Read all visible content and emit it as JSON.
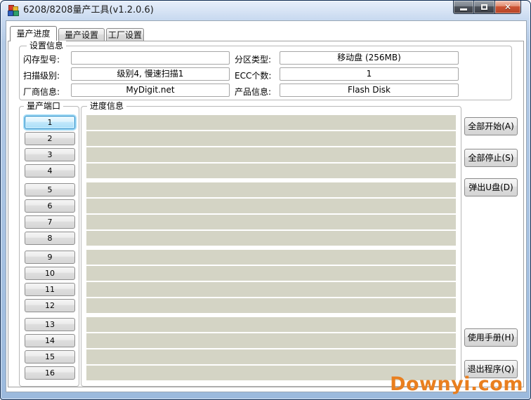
{
  "window": {
    "title": "6208/8208量产工具(v1.2.0.6)",
    "icons": {
      "close": "✕"
    }
  },
  "tabs": [
    {
      "label": "量产进度",
      "active": true
    },
    {
      "label": "量产设置",
      "active": false
    },
    {
      "label": "工厂设置",
      "active": false
    }
  ],
  "settings": {
    "group_label": "设置信息",
    "fields": [
      {
        "label": "闪存型号:",
        "value": ""
      },
      {
        "label": "分区类型:",
        "value": "移动盘 (256MB)"
      },
      {
        "label": "扫描级别:",
        "value": "级别4, 慢速扫描1"
      },
      {
        "label": "ECC个数:",
        "value": "1"
      },
      {
        "label": "厂商信息:",
        "value": "MyDigit.net"
      },
      {
        "label": "产品信息:",
        "value": "Flash Disk"
      }
    ]
  },
  "ports": {
    "group_label": "量产端口",
    "selected": "1",
    "buttons": [
      "1",
      "2",
      "3",
      "4",
      "5",
      "6",
      "7",
      "8",
      "9",
      "10",
      "11",
      "12",
      "13",
      "14",
      "15",
      "16"
    ]
  },
  "progress": {
    "group_label": "进度信息",
    "bar_count": 16
  },
  "actions": {
    "start_all": "全部开始(A)",
    "stop_all": "全部停止(S)",
    "eject": "弹出U盘(D)",
    "manual": "使用手册(H)",
    "exit": "退出程序(Q)"
  },
  "watermark": {
    "text": "Downyi.com",
    "color": "#e97f1f"
  },
  "colors": {
    "progress_bar": "#d4d4c5",
    "selected_port_border": "#2a8cc8",
    "close_button": "#cd5434",
    "frame": "#a7c2e2"
  }
}
